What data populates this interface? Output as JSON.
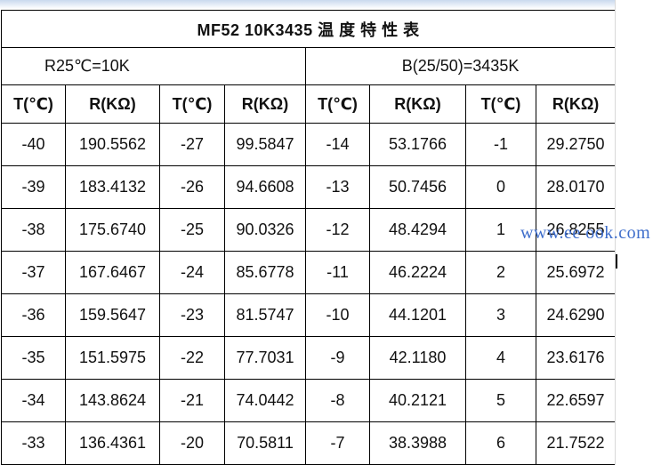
{
  "table": {
    "title": "MF52 10K3435 温 度 特 性 表",
    "params": {
      "r25": "R25℃=10K",
      "b_value": "B(25/50)=3435K"
    },
    "headers": [
      "T(℃)",
      "R(KΩ)",
      "T(℃)",
      "R(KΩ)",
      "T(℃)",
      "R(KΩ)",
      "T(℃)",
      "R(KΩ)"
    ],
    "rows": [
      [
        "-40",
        "190.5562",
        "-27",
        "99.5847",
        "-14",
        "53.1766",
        "-1",
        "29.2750"
      ],
      [
        "-39",
        "183.4132",
        "-26",
        "94.6608",
        "-13",
        "50.7456",
        "0",
        "28.0170"
      ],
      [
        "-38",
        "175.6740",
        "-25",
        "90.0326",
        "-12",
        "48.4294",
        "1",
        "26.8255"
      ],
      [
        "-37",
        "167.6467",
        "-24",
        "85.6778",
        "-11",
        "46.2224",
        "2",
        "25.6972"
      ],
      [
        "-36",
        "159.5647",
        "-23",
        "81.5747",
        "-10",
        "44.1201",
        "3",
        "24.6290"
      ],
      [
        "-35",
        "151.5975",
        "-22",
        "77.7031",
        "-9",
        "42.1180",
        "4",
        "23.6176"
      ],
      [
        "-34",
        "143.8624",
        "-21",
        "74.0442",
        "-8",
        "40.2121",
        "5",
        "22.6597"
      ],
      [
        "-33",
        "136.4361",
        "-20",
        "70.5811",
        "-7",
        "38.3988",
        "6",
        "21.7522"
      ]
    ]
  },
  "watermark": "www.ee ook.com",
  "colors": {
    "watermark": "#3f6ecb",
    "border": "#000000",
    "top_band": "#c9d9ee"
  }
}
